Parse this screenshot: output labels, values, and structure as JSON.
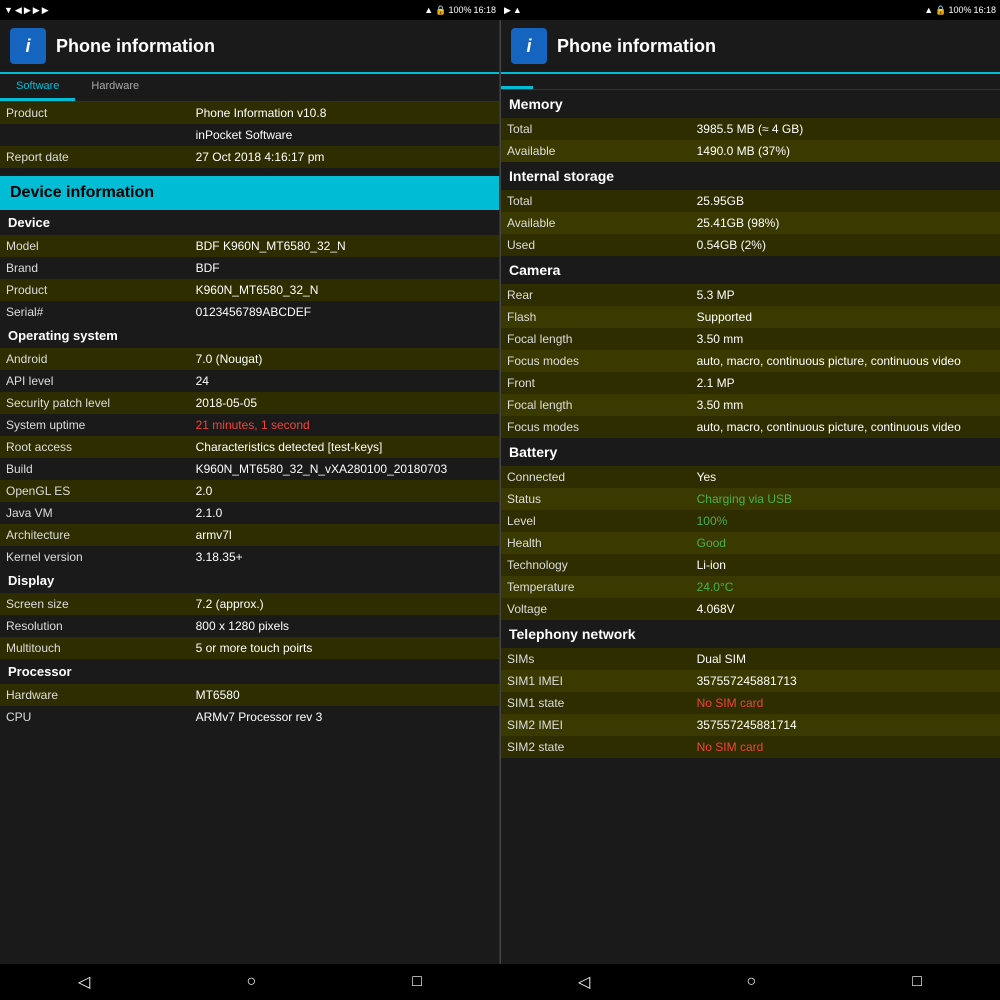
{
  "statusBar": {
    "leftIcons": "▼ ◀ ▶ ▶ ▶",
    "rightBattery": "100%",
    "rightTime": "16:18",
    "leftBattery": "100%",
    "leftTime": "16:18"
  },
  "appHeader": {
    "title": "Phone information",
    "iconLabel": "i"
  },
  "leftPanel": {
    "tabs": [
      {
        "label": "Software",
        "active": true
      },
      {
        "label": "Hardware",
        "active": false
      }
    ],
    "software": {
      "rows": [
        {
          "key": "Product",
          "value": "Phone Information v10.8"
        },
        {
          "key": "",
          "value": "inPocket Software"
        },
        {
          "key": "Report date",
          "value": "27 Oct 2018 4:16:17 pm"
        }
      ]
    },
    "deviceInfoBanner": "Device information",
    "device": {
      "header": "Device",
      "rows": [
        {
          "key": "Model",
          "value": "BDF K960N_MT6580_32_N"
        },
        {
          "key": "Brand",
          "value": "BDF"
        },
        {
          "key": "Product",
          "value": "K960N_MT6580_32_N"
        },
        {
          "key": "Serial#",
          "value": "0123456789ABCDEF"
        }
      ]
    },
    "os": {
      "header": "Operating system",
      "rows": [
        {
          "key": "Android",
          "value": "7.0 (Nougat)",
          "color": "normal"
        },
        {
          "key": "API level",
          "value": "24",
          "color": "normal"
        },
        {
          "key": "Security patch level",
          "value": "2018-05-05",
          "color": "normal"
        },
        {
          "key": "System uptime",
          "value": "21 minutes, 1 second",
          "color": "red"
        },
        {
          "key": "Root access",
          "value": "Characteristics detected [test-keys]",
          "color": "normal"
        },
        {
          "key": "Build",
          "value": "K960N_MT6580_32_N_vXA280100_20180703",
          "color": "normal"
        },
        {
          "key": "OpenGL ES",
          "value": "2.0",
          "color": "normal"
        },
        {
          "key": "Java VM",
          "value": "2.1.0",
          "color": "normal"
        },
        {
          "key": "Architecture",
          "value": "armv7l",
          "color": "normal"
        },
        {
          "key": "Kernel version",
          "value": "3.18.35+",
          "color": "normal"
        }
      ]
    },
    "display": {
      "header": "Display",
      "rows": [
        {
          "key": "Screen size",
          "value": "7.2 (approx.)"
        },
        {
          "key": "Resolution",
          "value": "800 x 1280 pixels"
        },
        {
          "key": "Multitouch",
          "value": "5 or more touch poirts"
        }
      ]
    },
    "processor": {
      "header": "Processor",
      "rows": [
        {
          "key": "Hardware",
          "value": "MT6580"
        },
        {
          "key": "CPU",
          "value": "ARMv7 Processor rev 3"
        }
      ]
    }
  },
  "rightPanel": {
    "memory": {
      "header": "Memory",
      "rows": [
        {
          "key": "Total",
          "value": "3985.5 MB (≈ 4 GB)"
        },
        {
          "key": "Available",
          "value": "1490.0 MB (37%)"
        }
      ]
    },
    "internalStorage": {
      "header": "Internal storage",
      "rows": [
        {
          "key": "Total",
          "value": "25.95GB"
        },
        {
          "key": "Available",
          "value": "25.41GB (98%)"
        },
        {
          "key": "Used",
          "value": "0.54GB (2%)"
        }
      ]
    },
    "camera": {
      "header": "Camera",
      "rows": [
        {
          "key": "Rear",
          "value": "5.3 MP",
          "color": "normal"
        },
        {
          "key": "Flash",
          "value": "Supported",
          "color": "normal"
        },
        {
          "key": "Focal length",
          "value": "3.50 mm",
          "color": "normal"
        },
        {
          "key": "Focus modes",
          "value": "auto, macro, continuous picture, continuous video",
          "color": "normal"
        },
        {
          "key": "Front",
          "value": "2.1 MP",
          "color": "normal"
        },
        {
          "key": "Focal length",
          "value": "3.50 mm",
          "color": "normal"
        },
        {
          "key": "Focus modes",
          "value": "auto, macro, continuous picture, continuous video",
          "color": "normal"
        }
      ]
    },
    "battery": {
      "header": "Battery",
      "rows": [
        {
          "key": "Connected",
          "value": "Yes",
          "color": "normal"
        },
        {
          "key": "Status",
          "value": "Charging via USB",
          "color": "green"
        },
        {
          "key": "Level",
          "value": "100%",
          "color": "green"
        },
        {
          "key": "Health",
          "value": "Good",
          "color": "green"
        },
        {
          "key": "Technology",
          "value": "Li-ion",
          "color": "normal"
        },
        {
          "key": "Temperature",
          "value": "24.0°C",
          "color": "green"
        },
        {
          "key": "Voltage",
          "value": "4.068V",
          "color": "normal"
        }
      ]
    },
    "telephony": {
      "header": "Telephony network",
      "rows": [
        {
          "key": "SIMs",
          "value": "Dual SIM",
          "color": "normal"
        },
        {
          "key": "SIM1 IMEI",
          "value": "357557245881713",
          "color": "normal"
        },
        {
          "key": "SIM1 state",
          "value": "No SIM card",
          "color": "red"
        },
        {
          "key": "SIM2 IMEI",
          "value": "357557245881714",
          "color": "normal"
        },
        {
          "key": "SIM2 state",
          "value": "No SIM card",
          "color": "red"
        }
      ]
    }
  },
  "navBar": {
    "backIcon": "◁",
    "homeIcon": "○",
    "recentIcon": "□"
  }
}
